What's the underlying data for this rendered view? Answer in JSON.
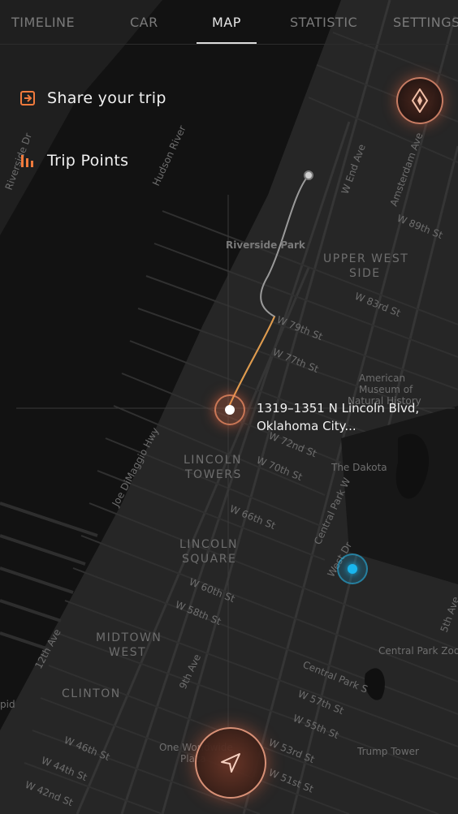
{
  "nav": {
    "tabs": [
      "TIMELINE",
      "CAR",
      "MAP",
      "STATISTIC",
      "SETTINGS"
    ],
    "active": "MAP"
  },
  "menu": {
    "share_label": "Share your trip",
    "points_label": "Trip Points"
  },
  "trip": {
    "address_line1": "1319–1351 N Lincoln Blvd,",
    "address_line2": "Oklahoma City..."
  },
  "map_labels": {
    "hudson_river": "Hudson River",
    "riverside_park": "Riverside Park",
    "riverside_drive": "Riverside Dr",
    "upper_west_1": "UPPER WEST",
    "upper_west_2": "SIDE",
    "w_end_ave": "W End Ave",
    "amsterdam_ave": "Amsterdam Ave",
    "w_89th": "W 89th St",
    "w_83rd": "W 83rd St",
    "w_79th": "W 79th St",
    "w_77th": "W 77th St",
    "w_72nd": "W 72nd St",
    "w_70th": "W 70th St",
    "w_66th": "W 66th St",
    "w_60th": "W 60th St",
    "w_58th": "W 58th St",
    "w_57th": "W 57th St",
    "w_55th": "W 55th St",
    "w_53rd": "W 53rd St",
    "w_51st": "W 51st St",
    "w_46th": "W 46th St",
    "w_44th": "W 44th St",
    "w_42nd": "W 42nd St",
    "museum_1": "American",
    "museum_2": "Museum of",
    "museum_3": "Natural History",
    "dakota": "The Dakota",
    "lincoln_towers_1": "LINCOLN",
    "lincoln_towers_2": "TOWERS",
    "lincoln_square_1": "LINCOLN",
    "lincoln_square_2": "SQUARE",
    "joe_dimaggio": "Joe DiMaggio Hwy",
    "central_park_w": "Central Park W",
    "west_dr": "West Dr",
    "midtown_1": "MIDTOWN",
    "midtown_2": "WEST",
    "clinton": "CLINTON",
    "twelfth_ave": "12th Ave",
    "ninth_ave": "9th Ave",
    "central_park_s": "Central Park S",
    "central_park_zoo": "Central Park Zoo",
    "fifth_ave": "5th Ave",
    "one_worldwide_1": "One Worldwide",
    "one_worldwide_2": "Plaza",
    "trump_tower": "Trump Tower",
    "pid": "pid"
  },
  "colors": {
    "accent": "#f07a3c",
    "route_gray": "#bdbdbd",
    "route_orange": "#e09a4a",
    "location_blue": "#19b6ee"
  },
  "icons": {
    "share": "share-icon",
    "points": "trip-points-icon",
    "compass": "compass-icon",
    "locate": "navigation-arrow-icon"
  }
}
